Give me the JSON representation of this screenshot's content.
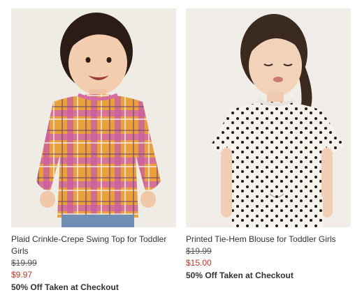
{
  "products": [
    {
      "name": "Plaid Crinkle-Crepe Swing Top for Toddler Girls",
      "was_price": "$19.99",
      "sale_price": "$9.97",
      "promo": "50% Off Taken at Checkout"
    },
    {
      "name": "Printed Tie-Hem Blouse for Toddler Girls",
      "was_price": "$19.99",
      "sale_price": "$15.00",
      "promo": "50% Off Taken at Checkout"
    }
  ],
  "colors": {
    "sale_price": "#c0352b",
    "background": "#ffffff"
  }
}
